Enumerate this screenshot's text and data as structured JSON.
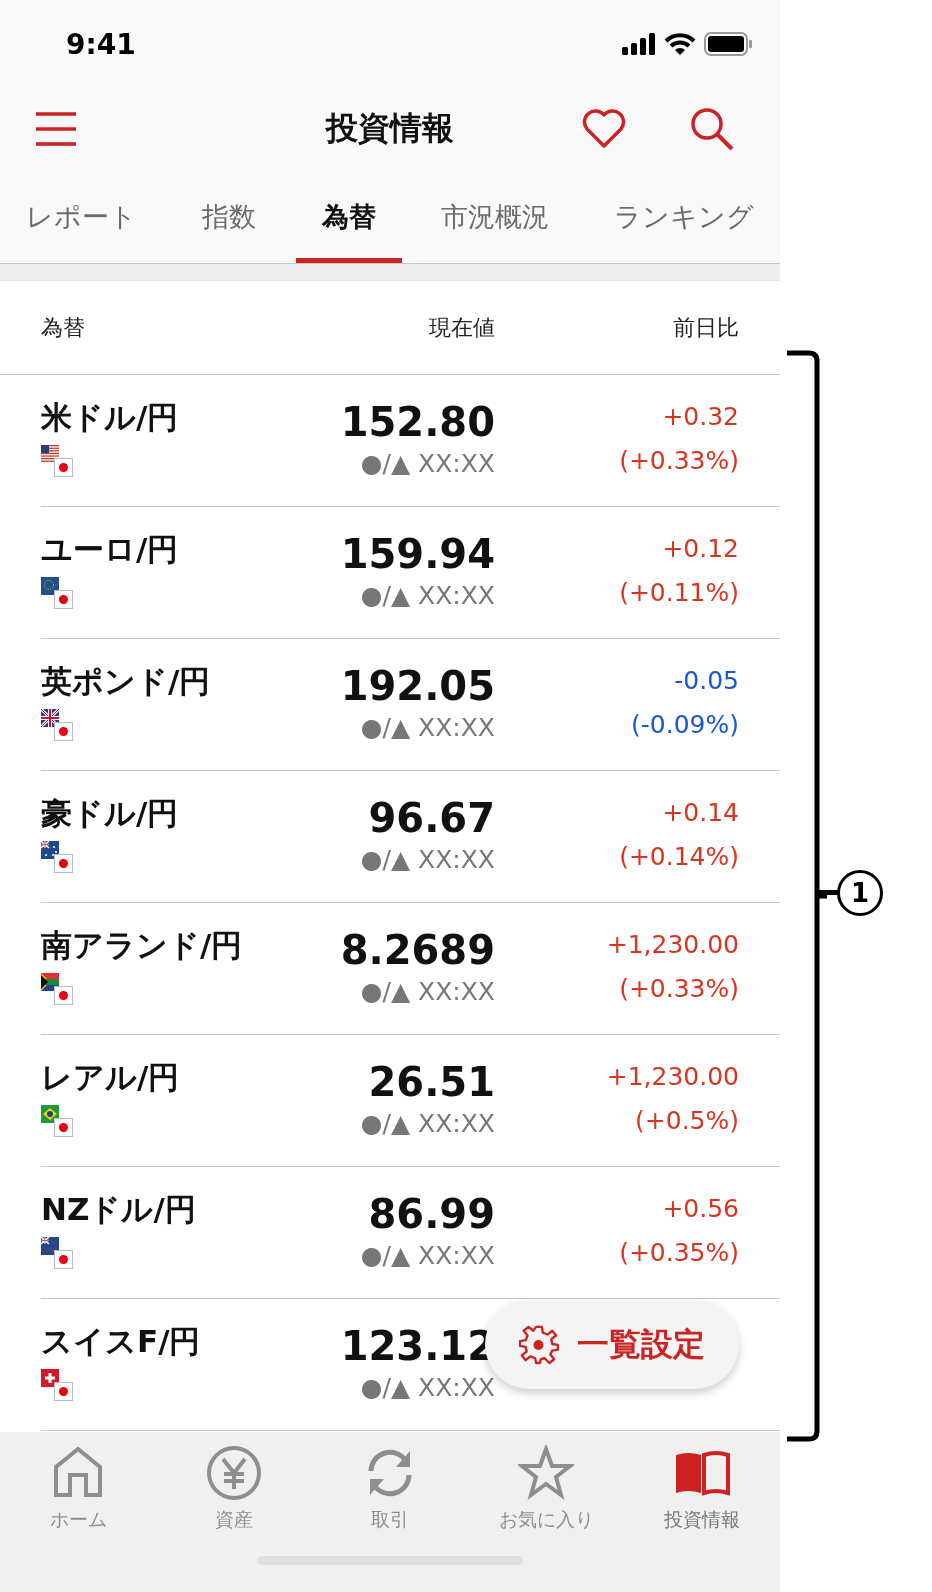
{
  "status_bar": {
    "time": "9:41"
  },
  "header": {
    "title": "投資情報"
  },
  "tabs": [
    {
      "label": "レポート",
      "selected": false
    },
    {
      "label": "指数",
      "selected": false
    },
    {
      "label": "為替",
      "selected": true
    },
    {
      "label": "市況概況",
      "selected": false
    },
    {
      "label": "ランキング",
      "selected": false
    }
  ],
  "table": {
    "columns": [
      "為替",
      "現在値",
      "前日比"
    ],
    "rows": [
      {
        "name": "米ドル/円",
        "kind": "us",
        "price": "152.80",
        "time": "●/▲ XX:XX",
        "change": "+0.32",
        "change_pct": "(+0.33%)",
        "color": "#d9341e"
      },
      {
        "name": "ユーロ/円",
        "kind": "eu",
        "price": "159.94",
        "time": "●/▲ XX:XX",
        "change": "+0.12",
        "change_pct": "(+0.11%)",
        "color": "#d9341e"
      },
      {
        "name": "英ポンド/円",
        "kind": "gb",
        "price": "192.05",
        "time": "●/▲ XX:XX",
        "change": "-0.05",
        "change_pct": "(-0.09%)",
        "color": "#1a56d6"
      },
      {
        "name": "豪ドル/円",
        "kind": "au",
        "price": "96.67",
        "time": "●/▲ XX:XX",
        "change": "+0.14",
        "change_pct": "(+0.14%)",
        "color": "#d9341e"
      },
      {
        "name": "南アランド/円",
        "kind": "za",
        "price": "8.2689",
        "time": "●/▲ XX:XX",
        "change": "+1,230.00",
        "change_pct": "(+0.33%)",
        "color": "#d9341e"
      },
      {
        "name": "レアル/円",
        "kind": "br",
        "price": "26.51",
        "time": "●/▲ XX:XX",
        "change": "+1,230.00",
        "change_pct": "(+0.5%)",
        "color": "#d9341e"
      },
      {
        "name": "NZドル/円",
        "kind": "nz",
        "price": "86.99",
        "time": "●/▲ XX:XX",
        "change": "+0.56",
        "change_pct": "(+0.35%)",
        "color": "#d9341e"
      },
      {
        "name": "スイスF/円",
        "kind": "ch",
        "price": "123.12",
        "time": "●/▲ XX:XX"
      }
    ]
  },
  "floating_button": {
    "label": "一覧設定"
  },
  "bottom_nav": [
    {
      "label": "ホーム",
      "kind": "home",
      "selected": false
    },
    {
      "label": "資産",
      "kind": "yen",
      "selected": false
    },
    {
      "label": "取引",
      "kind": "refresh",
      "selected": false
    },
    {
      "label": "お気に入り",
      "kind": "star",
      "selected": false
    },
    {
      "label": "投資情報",
      "kind": "book",
      "selected": true
    }
  ],
  "annotation": {
    "label": "1"
  }
}
